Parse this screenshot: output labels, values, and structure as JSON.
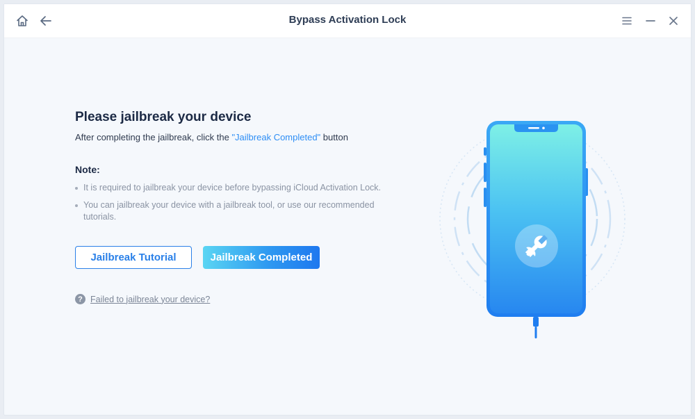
{
  "window": {
    "title": "Bypass Activation Lock"
  },
  "titlebar": {
    "left_icons": [
      "home-icon",
      "back-arrow-icon"
    ],
    "right_icons": [
      "menu-icon",
      "minimize-icon",
      "close-icon"
    ]
  },
  "main": {
    "heading": "Please jailbreak your device",
    "subtitle_prefix": "After completing the jailbreak, click the ",
    "subtitle_highlight": "\"Jailbreak Completed\"",
    "subtitle_suffix": " button",
    "note_title": "Note:",
    "notes": [
      "It is required to jailbreak your device before bypassing iCloud Activation Lock.",
      "You can jailbreak your device with a jailbreak tool, or use our recommended tutorials."
    ],
    "buttons": {
      "tutorial": "Jailbreak Tutorial",
      "completed": "Jailbreak Completed"
    },
    "help_link": "Failed to jailbreak your device?",
    "help_icon_glyph": "?"
  },
  "colors": {
    "accent": "#2a80e8",
    "heading": "#1c2a45",
    "note_text": "#8a93a3",
    "phone_top": "#7ef0e6",
    "phone_bottom": "#2787f0"
  },
  "illustration": {
    "icons": [
      "phone-icon",
      "wrench-icon"
    ]
  }
}
